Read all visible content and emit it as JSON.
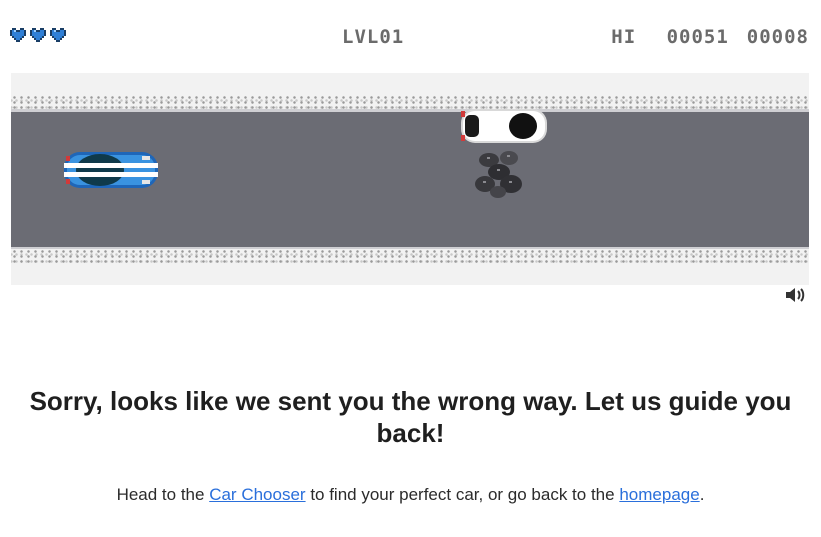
{
  "hud": {
    "lives": 3,
    "heart_color": "#2f7fd6",
    "level": "LVL01",
    "hi_label": "HI",
    "hi_score": "00051",
    "score": "00008"
  },
  "game": {
    "player_car_color": "#2a7fd0",
    "obstacle_car_color": "#ffffff",
    "obstacle": "rocks",
    "sound_icon": "speaker-icon"
  },
  "message": {
    "heading": "Sorry, looks like we sent you the wrong way. Let us guide you back!",
    "sub_before": "Head to the",
    "link_car_chooser": "Car Chooser",
    "sub_middle": "to find your perfect car, or go back to the",
    "link_homepage": "homepage",
    "sub_after": "."
  }
}
